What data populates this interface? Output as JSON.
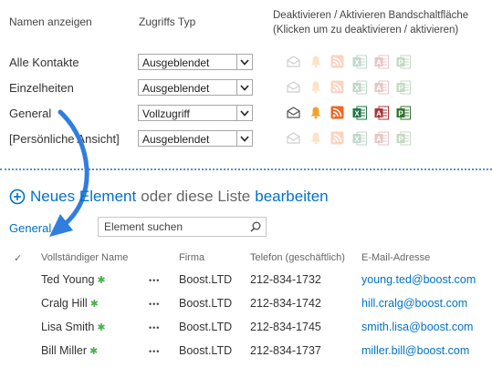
{
  "header": {
    "col_name": "Namen anzeigen",
    "col_access": "Zugriffs Typ",
    "col_toggle_line1": "Deaktivieren / Aktivieren Bandschaltfläche",
    "col_toggle_line2": "(Klicken um zu deaktivieren / aktivieren)"
  },
  "views": [
    {
      "name": "Alle Kontakte",
      "access": "Ausgeblendet",
      "icons_active": false
    },
    {
      "name": "Einzelheiten",
      "access": "Ausgeblendet",
      "icons_active": false
    },
    {
      "name": "General",
      "access": "Vollzugriff",
      "icons_active": true
    },
    {
      "name": "[Persönliche Ansicht]",
      "access": "Ausgeblendet",
      "icons_active": false
    }
  ],
  "ribbon_icons": [
    "envelope-icon",
    "bell-icon",
    "rss-icon",
    "excel-icon",
    "access-icon",
    "project-icon"
  ],
  "list": {
    "new_item": "Neues Element",
    "or_text": "oder diese Liste",
    "edit": "bearbeiten",
    "view_name": "General",
    "search_placeholder": "Element suchen",
    "columns": {
      "check": "✓",
      "name": "Vollständiger Name",
      "company": "Firma",
      "phone": "Telefon (geschäftlich)",
      "email": "E-Mail-Adresse"
    },
    "rows": [
      {
        "name": "Ted Young",
        "company": "Boost.LTD",
        "phone": "212-834-1732",
        "email": "young.ted@boost.com"
      },
      {
        "name": "Cralg Hill",
        "company": "Boost.LTD",
        "phone": "212-834-1742",
        "email": "hill.cralg@boost.com"
      },
      {
        "name": "Lisa Smith",
        "company": "Boost.LTD",
        "phone": "212-834-1745",
        "email": "smith.lisa@boost.com"
      },
      {
        "name": "Bill Miller",
        "company": "Boost.LTD",
        "phone": "212-834-1737",
        "email": "miller.bill@boost.com"
      }
    ]
  },
  "colors": {
    "accent": "#0072c6",
    "arrow": "#2f7ee0",
    "divider": "#5b8fd0"
  }
}
